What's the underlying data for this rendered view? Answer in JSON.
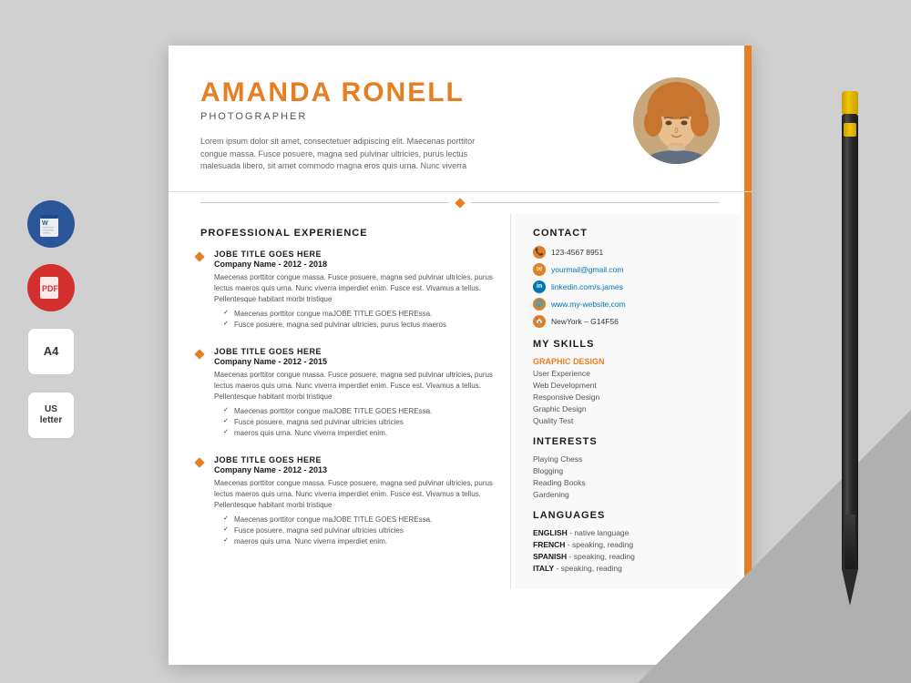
{
  "left_icons": {
    "word_label": "W",
    "pdf_label": "PDF",
    "a4_label": "A4",
    "us_label": "US\nletter"
  },
  "header": {
    "name": "AMANDA RONELL",
    "title": "PHOTOGRAPHER",
    "summary": "Lorem ipsum dolor sit amet, consectetuer adipiscing elit. Maecenas porttitor congue massa. Fusce posuere, magna sed pulvinar ultricies, purus lectus malesuada libero, sit amet commodo magna eros quis urna. Nunc viverra"
  },
  "experience": {
    "section_title": "PROFESSIONAL EXPERIENCE",
    "jobs": [
      {
        "title": "JOBE TITLE GOES HERE",
        "company": "Company Name  - 2012 - 2018",
        "desc": "Maecenas porttitor congue massa. Fusce posuere, magna sed pulvinar ultricies, purus lectus maeros quis urna. Nunc viverra imperdiet enim. Fusce est. Vivamus a tellus. Pellentesque habitant morbi tristique",
        "bullets": [
          "Maecenas porttitor congue maJOBE TITLE GOES HEREssa.",
          "Fusce posuere, magna sed pulvinar ultricies, purus lectus maeros"
        ]
      },
      {
        "title": "JOBE TITLE GOES HERE",
        "company": "Company Name  - 2012 - 2015",
        "desc": "Maecenas porttitor congue massa. Fusce posuere, magna sed pulvinar ultricies, purus lectus maeros quis urna. Nunc viverra imperdiet enim. Fusce est. Vivamus a tellus. Pellentesque habitant morbi tristique",
        "bullets": [
          "Maecenas porttitor congue maJOBE TITLE GOES HEREssa.",
          "Fusce posuere, magna sed pulvinar ultricies ultricies",
          "maeros quis urna. Nunc viverra imperdiet enim."
        ]
      },
      {
        "title": "JOBE TITLE GOES HERE",
        "company": "Company Name  - 2012 - 2013",
        "desc": "Maecenas porttitor congue massa. Fusce posuere, magna sed pulvinar ultricies, purus lectus maeros quis urna. Nunc viverra imperdiet enim. Fusce est. Vivamus a tellus. Pellentesque habitant morbi tristique",
        "bullets": [
          "Maecenas porttitor congue maJOBE TITLE GOES HEREssa.",
          "Fusce posuere, magna sed pulvinar ultricies ultricies",
          "maeros quis urna. Nunc viverra imperdiet enim."
        ]
      }
    ]
  },
  "contact": {
    "section_title": "CONTACT",
    "phone": "123-4567 8951",
    "email": "yourmail@gmail.com",
    "linkedin": "linkedin.com/s.james",
    "website": "www.my-website.com",
    "location": "NewYork – G14F56"
  },
  "skills": {
    "section_title": "MY SKILLS",
    "highlight": "GRAPHIC DESIGN",
    "items": [
      "User Experience",
      "Web Development",
      "Responsive Design",
      "Graphic Design",
      "Quality Test"
    ]
  },
  "interests": {
    "section_title": "INTERESTS",
    "items": [
      "Playing Chess",
      "Blogging",
      "Reading Books",
      "Gardening"
    ]
  },
  "languages": {
    "section_title": "LANGUAGES",
    "items": [
      {
        "lang": "ENGLISH",
        "level": "native language"
      },
      {
        "lang": "FRENCH",
        "level": "speaking, reading"
      },
      {
        "lang": "SPANISH",
        "level": "speaking, reading"
      },
      {
        "lang": "ITALY",
        "level": "speaking, reading"
      }
    ]
  }
}
